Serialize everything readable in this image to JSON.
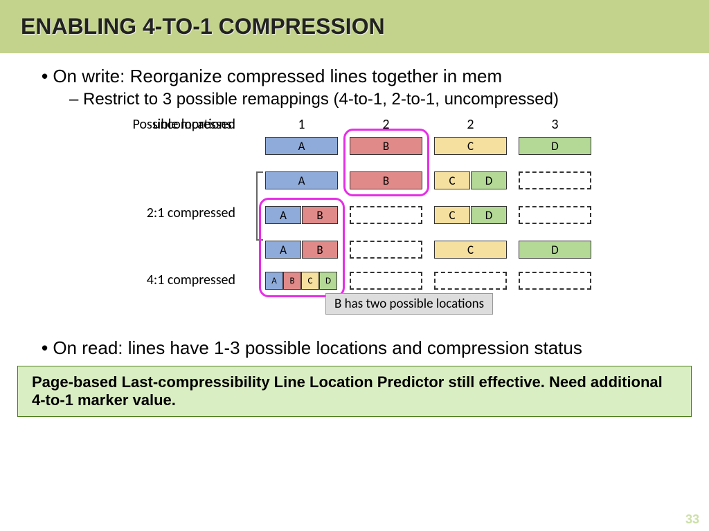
{
  "title": "ENABLING 4-TO-1 COMPRESSION",
  "bullets": {
    "b1": "On write: Reorganize compressed lines together in mem",
    "b1sub": "Restrict to 3 possible remappings (4-to-1, 2-to-1, uncompressed)",
    "b2": "On read: lines have 1-3 possible locations and compression status"
  },
  "labels": {
    "possible": "Possible locations:",
    "uncompressed": "uncompressed",
    "two_to_one": "2:1 compressed",
    "four_to_one": "4:1 compressed"
  },
  "cols": [
    "1",
    "2",
    "2",
    "3"
  ],
  "cells": {
    "A": "A",
    "B": "B",
    "C": "C",
    "D": "D"
  },
  "note": "B has two possible locations",
  "greenbox": "Page-based Last-compressibility Line Location Predictor still effective. Need additional 4-to-1 marker value.",
  "page": "33"
}
